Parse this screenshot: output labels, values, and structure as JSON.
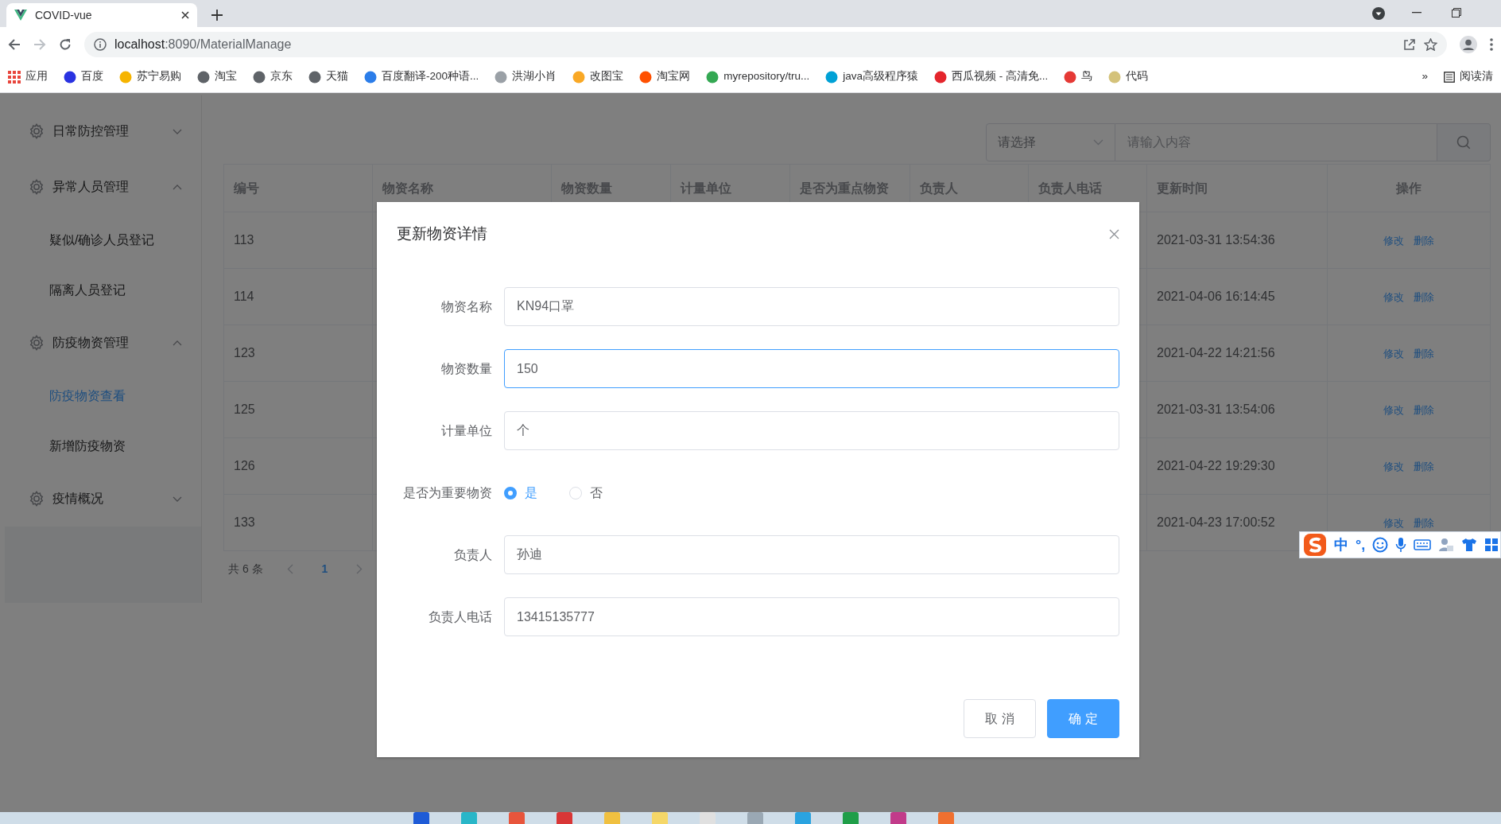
{
  "browser": {
    "tab_title": "COVID-vue",
    "url_host": "localhost",
    "url_path": ":8090/MaterialManage",
    "bookmarks": [
      {
        "kind": "apps",
        "label": "应用",
        "color": "#e8453c"
      },
      {
        "kind": "site",
        "label": "百度",
        "color": "#2932e1"
      },
      {
        "kind": "site",
        "label": "苏宁易购",
        "color": "#f6b400"
      },
      {
        "kind": "site",
        "label": "淘宝",
        "color": "#5f6368"
      },
      {
        "kind": "site",
        "label": "京东",
        "color": "#5f6368"
      },
      {
        "kind": "site",
        "label": "天猫",
        "color": "#5f6368"
      },
      {
        "kind": "site",
        "label": "百度翻译-200种语...",
        "color": "#2b7de9"
      },
      {
        "kind": "site",
        "label": "洪湖小肖",
        "color": "#9aa0a6"
      },
      {
        "kind": "site",
        "label": "改图宝",
        "color": "#f9a825"
      },
      {
        "kind": "site",
        "label": "淘宝网",
        "color": "#ff5000"
      },
      {
        "kind": "site",
        "label": "myrepository/tru...",
        "color": "#34a853"
      },
      {
        "kind": "site",
        "label": "java高级程序猿",
        "color": "#00a1d6"
      },
      {
        "kind": "site",
        "label": "西瓜视频 - 高清免...",
        "color": "#e4252c"
      },
      {
        "kind": "site",
        "label": "鸟",
        "color": "#e53935"
      },
      {
        "kind": "site",
        "label": "代码",
        "color": "#d4c27a"
      }
    ],
    "more": "»",
    "reading_list": "阅读清"
  },
  "sidebar": {
    "items": [
      {
        "label": "日常防控管理",
        "expanded": false
      },
      {
        "label": "异常人员管理",
        "expanded": true,
        "children": [
          {
            "label": "疑似/确诊人员登记",
            "selected": false
          },
          {
            "label": "隔离人员登记",
            "selected": false
          }
        ]
      },
      {
        "label": "防疫物资管理",
        "expanded": true,
        "children": [
          {
            "label": "防疫物资查看",
            "selected": true
          },
          {
            "label": "新增防疫物资",
            "selected": false
          }
        ]
      },
      {
        "label": "疫情概况",
        "expanded": false
      }
    ]
  },
  "search": {
    "select_placeholder": "请选择",
    "placeholder": "请输入内容"
  },
  "table": {
    "columns": [
      "编号",
      "物资名称",
      "物资数量",
      "计量单位",
      "是否为重点物资",
      "负责人",
      "负责人电话",
      "更新时间",
      "操作"
    ],
    "rows": [
      {
        "id": "113",
        "updated": "2021-03-31 13:54:36",
        "actions": [
          "修改",
          "删除"
        ]
      },
      {
        "id": "114",
        "updated": "2021-04-06 16:14:45",
        "actions": [
          "修改",
          "删除"
        ]
      },
      {
        "id": "123",
        "updated": "2021-04-22 14:21:56",
        "actions": [
          "修改",
          "删除"
        ]
      },
      {
        "id": "125",
        "updated": "2021-03-31 13:54:06",
        "actions": [
          "修改",
          "删除"
        ]
      },
      {
        "id": "126",
        "updated": "2021-04-22 19:29:30",
        "actions": [
          "修改",
          "删除"
        ]
      },
      {
        "id": "133",
        "updated": "2021-04-23 17:00:52",
        "actions": [
          "修改",
          "删除"
        ]
      }
    ]
  },
  "pagination": {
    "total": "共 6 条",
    "pages": [
      {
        "label": "1",
        "selected": true
      }
    ]
  },
  "dialog": {
    "title": "更新物资详情",
    "fields": [
      {
        "kind": "text",
        "label": "物资名称",
        "value": "KN94口罩",
        "focused": false
      },
      {
        "kind": "text",
        "label": "物资数量",
        "value": "150",
        "focused": true
      },
      {
        "kind": "text",
        "label": "计量单位",
        "value": "个",
        "focused": false
      },
      {
        "kind": "radio",
        "label": "是否为重要物资",
        "options": [
          {
            "label": "是",
            "selected": true
          },
          {
            "label": "否",
            "selected": false
          }
        ]
      },
      {
        "kind": "text",
        "label": "负责人",
        "value": "孙迪",
        "focused": false
      },
      {
        "kind": "text",
        "label": "负责人电话",
        "value": "13415135777",
        "focused": false
      }
    ],
    "buttons": [
      {
        "label": "取 消",
        "primary": false
      },
      {
        "label": "确 定",
        "primary": true
      }
    ]
  },
  "ime_bar": {
    "mode": "中",
    "punct": "°,"
  }
}
